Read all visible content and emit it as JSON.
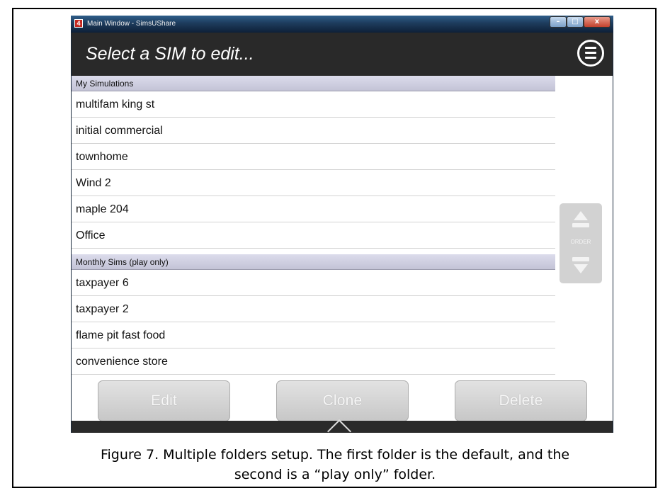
{
  "window": {
    "title": "Main Window - SimsUShare",
    "minimize_glyph": "–",
    "maximize_glyph": "□",
    "close_glyph": "x",
    "app_icon": "app-icon"
  },
  "header": {
    "title": "Select a SIM to edit...",
    "menu_icon": "hamburger-menu-icon"
  },
  "sections": [
    {
      "name": "My Simulations",
      "items": [
        "multifam king st",
        "initial commercial",
        "townhome",
        "Wind 2",
        "maple 204",
        "Office"
      ]
    },
    {
      "name": "Monthly Sims (play only)",
      "items": [
        "taxpayer 6",
        "taxpayer 2",
        "flame pit fast food",
        "convenience store"
      ]
    }
  ],
  "order_control": {
    "label": "ORDER",
    "up_icon": "order-up-icon",
    "down_icon": "order-down-icon"
  },
  "actions": {
    "edit": "Edit",
    "clone": "Clone",
    "delete": "Delete"
  },
  "caption": {
    "line1": "Figure 7. Multiple folders setup. The first folder is the default, and the",
    "line2": "second is a “play only” folder."
  }
}
